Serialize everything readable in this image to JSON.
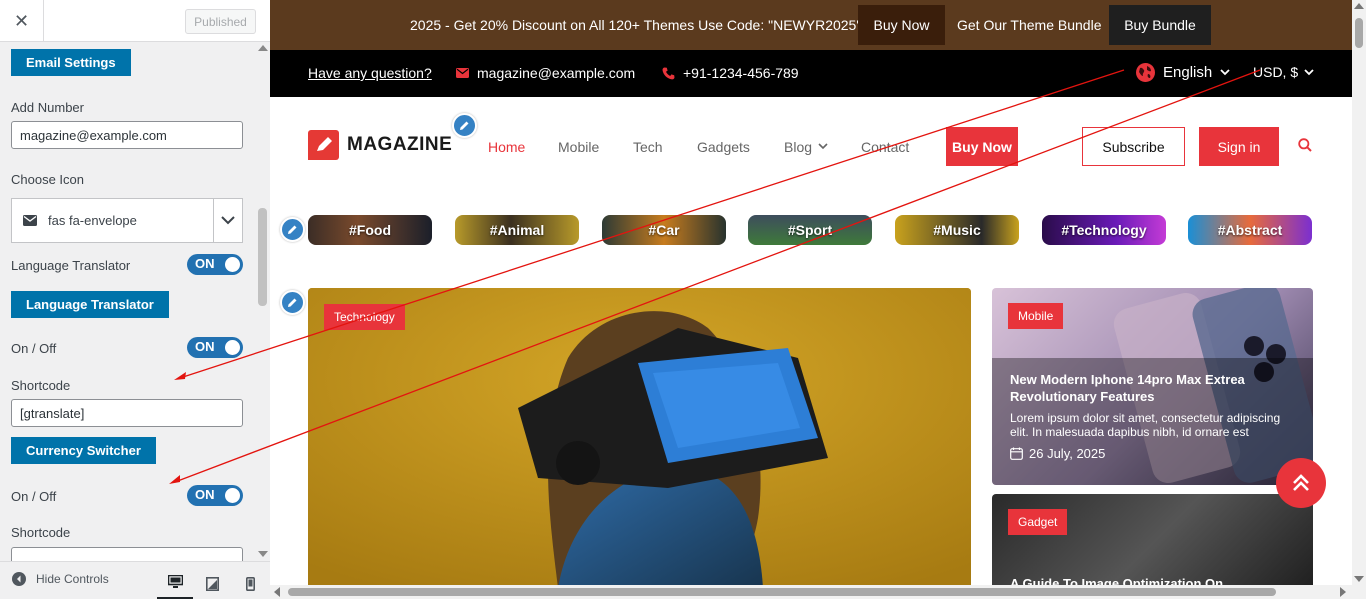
{
  "sidebar": {
    "close_label": "✕",
    "published_label": "Published",
    "email_settings_label": "Email Settings",
    "add_number_label": "Add Number",
    "add_number_value": "magazine@example.com",
    "choose_icon_label": "Choose Icon",
    "choose_icon_value": "fas fa-envelope",
    "language_translator_toggle_label": "Language Translator",
    "toggle_on": "ON",
    "language_translator_section": "Language Translator",
    "onoff_label": "On / Off",
    "shortcode_label": "Shortcode",
    "shortcode_value": "[gtranslate]",
    "currency_switcher_section": "Currency Switcher",
    "onoff_label_2": "On / Off",
    "shortcode_label_2": "Shortcode",
    "hide_controls_label": "Hide Controls"
  },
  "preview": {
    "promo": {
      "message": "2025 - Get 20% Discount on All 120+ Themes Use Code: \"NEWYR2025\"",
      "buy_now": "Buy Now",
      "bundle_text": "Get Our Theme Bundle",
      "buy_bundle": "Buy Bundle"
    },
    "topbar": {
      "question": "Have any question?",
      "email": "magazine@example.com",
      "phone": "+91-1234-456-789",
      "language": "English",
      "currency": "USD, $"
    },
    "nav": {
      "logo_text": "MAGAZINE",
      "items": [
        "Home",
        "Mobile",
        "Tech",
        "Gadgets",
        "Blog",
        "Contact"
      ],
      "buy_now": "Buy Now",
      "subscribe": "Subscribe",
      "sign_in": "Sign in"
    },
    "tags": [
      "#Food",
      "#Animal",
      "#Car",
      "#Sport",
      "#Music",
      "#Technology",
      "#Abstract"
    ],
    "hero": {
      "badge": "Technology"
    },
    "cards": [
      {
        "badge": "Mobile",
        "title": "New Modern Iphone 14pro Max Extrea Revolutionary Features",
        "excerpt": "Lorem ipsum dolor sit amet, consectetur adipiscing elit. In malesuada dapibus nibh, id ornare est",
        "date": "26 July, 2025"
      },
      {
        "badge": "Gadget",
        "title": "A Guide To Image Optimization On"
      }
    ]
  },
  "colors": {
    "accent": "#e8343b",
    "customizer_blue": "#0073aa",
    "promo_bg": "#5b3a1e",
    "topbar_bg": "#000000"
  }
}
